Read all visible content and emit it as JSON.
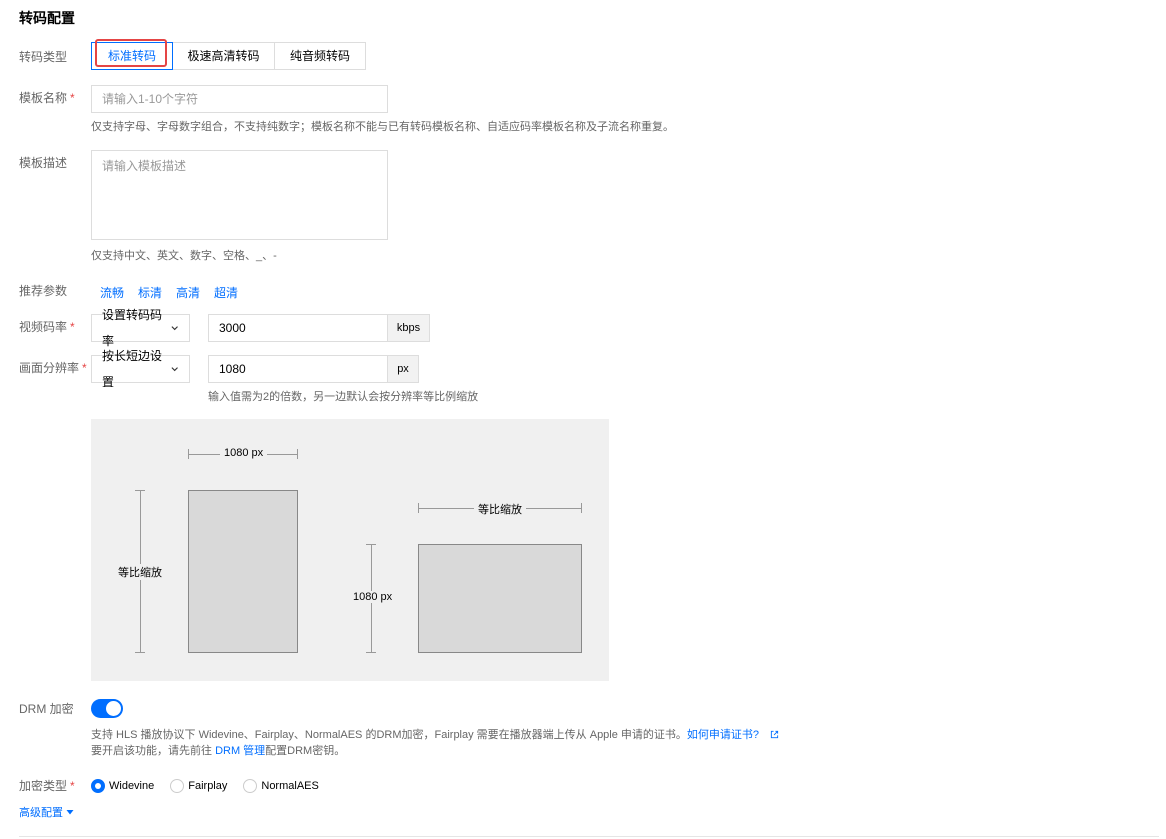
{
  "section_title": "转码配置",
  "transcode_type": {
    "label": "转码类型",
    "options": [
      "标准转码",
      "极速高清转码",
      "纯音频转码"
    ],
    "selected": "标准转码"
  },
  "template_name": {
    "label": "模板名称",
    "required_mark": "*",
    "placeholder": "请输入1-10个字符",
    "hint": "仅支持字母、字母数字组合，不支持纯数字；模板名称不能与已有转码模板名称、自适应码率模板名称及子流名称重复。"
  },
  "template_desc": {
    "label": "模板描述",
    "placeholder": "请输入模板描述",
    "hint": "仅支持中文、英文、数字、空格、_、-"
  },
  "recommend": {
    "label": "推荐参数",
    "options": [
      "流畅",
      "标清",
      "高清",
      "超清"
    ]
  },
  "video_bitrate": {
    "label": "视频码率",
    "required_mark": "*",
    "select_value": "设置转码码率",
    "value": "3000",
    "unit": "kbps"
  },
  "resolution": {
    "label": "画面分辨率",
    "required_mark": "*",
    "select_value": "按长短边设置",
    "value": "1080",
    "unit": "px",
    "hint": "输入值需为2的倍数，另一边默认会按分辨率等比例缩放"
  },
  "diagram": {
    "left_width_label": "1080 px",
    "left_height_label": "等比缩放",
    "right_width_label": "等比缩放",
    "right_height_label": "1080 px"
  },
  "drm": {
    "label": "DRM 加密",
    "enabled": true,
    "desc_line1": "支持 HLS 播放协议下 Widevine、Fairplay、NormalAES 的DRM加密，Fairplay 需要在播放器端上传从 Apple 申请的证书。",
    "cert_link": "如何申请证书?",
    "desc_line2_prefix": "要开启该功能，请先前往 ",
    "manage_link": "DRM 管理",
    "desc_line2_suffix": "配置DRM密钥。"
  },
  "encrypt_type": {
    "label": "加密类型",
    "required_mark": "*",
    "options": [
      "Widevine",
      "Fairplay",
      "NormalAES"
    ],
    "selected": "Widevine"
  },
  "advanced": {
    "label": "高级配置"
  },
  "colors": {
    "accent": "#006eff",
    "required": "#e54545",
    "highlight": "#e54545"
  }
}
